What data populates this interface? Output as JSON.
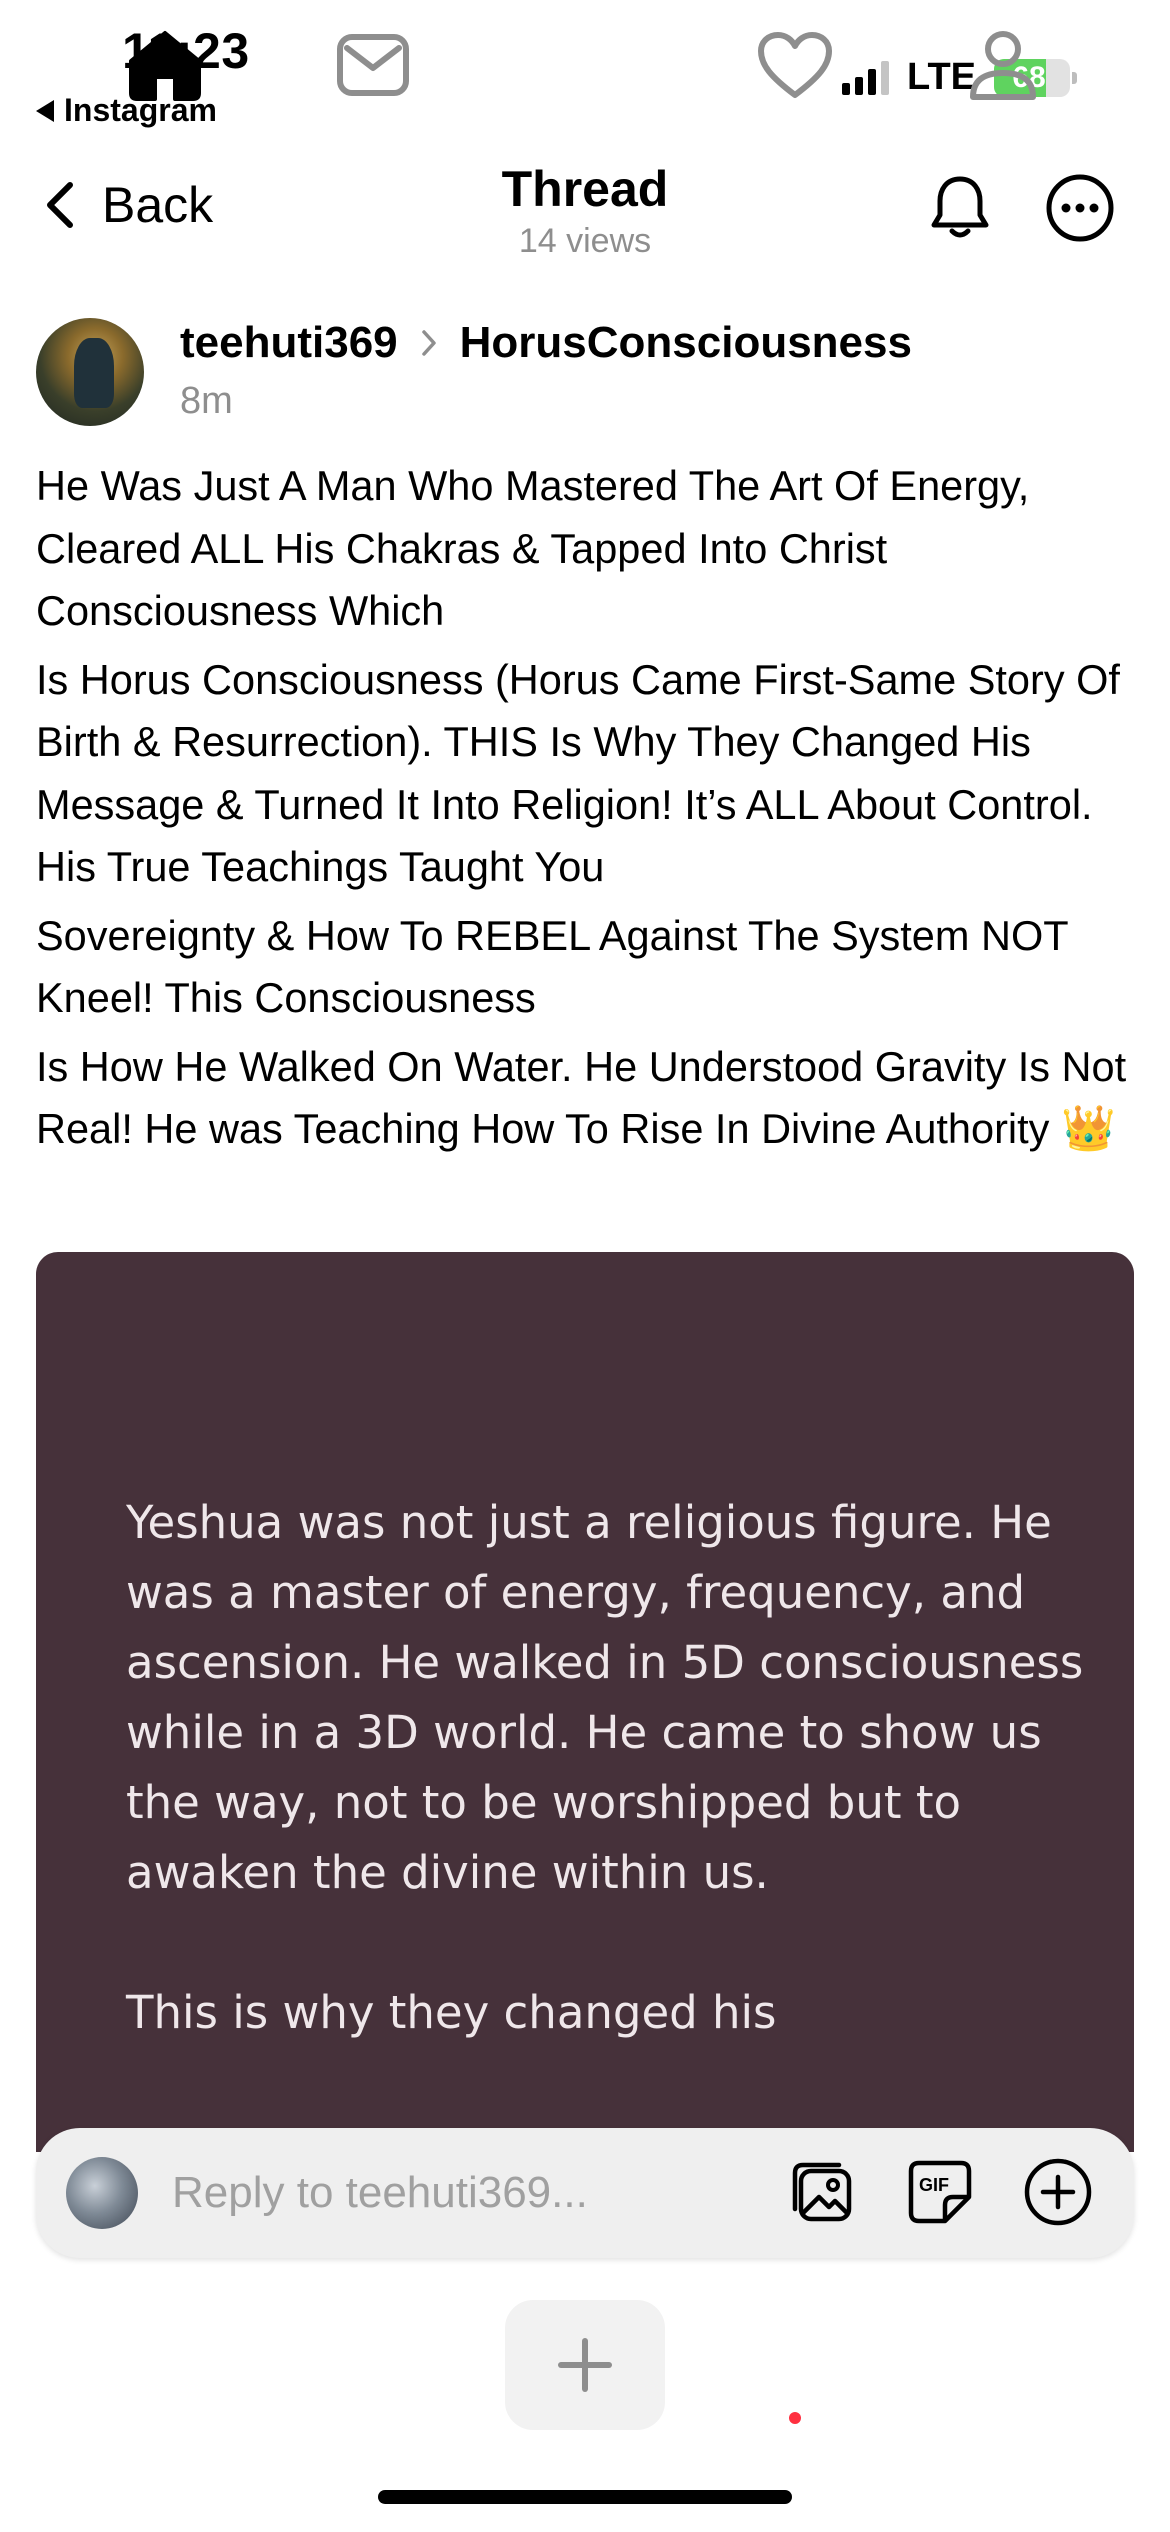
{
  "status_bar": {
    "time": "11:23",
    "back_app": "Instagram",
    "network": "LTE",
    "battery": "68"
  },
  "header": {
    "back_label": "Back",
    "title": "Thread",
    "views": "14 views"
  },
  "post": {
    "username": "teehuti369",
    "community": "HorusConsciousness",
    "time": "8m",
    "paragraphs": [
      "He Was Just A Man Who Mastered The Art Of Energy, Cleared ALL His Chakras & Tapped Into Christ Consciousness Which",
      "Is Horus Consciousness (Horus Came First-Same Story Of Birth & Resurrection). THIS Is Why They Changed His Message & Turned It Into Religion! It’s ALL About Control. His True Teachings Taught You",
      "Sovereignty & How To REBEL Against The System NOT Kneel! This Consciousness",
      "Is How He Walked On Water. He Understood Gravity Is Not Real! He was Teaching How To Rise In Divine Authority"
    ],
    "emoji": "👑",
    "image_text": {
      "p1": "Yeshua was not just a religious figure. He was a master of energy, frequency, and ascension. He walked in 5D consciousness while in a 3D world. He came to show us the way, not to be worshipped but to awaken the divine within us.",
      "p2": "This is why they changed his"
    }
  },
  "reply": {
    "placeholder": "Reply to teehuti369..."
  },
  "colors": {
    "image_bg": "#46313a",
    "notification_dot": "#ff3040",
    "battery_green": "#5fd35f"
  }
}
